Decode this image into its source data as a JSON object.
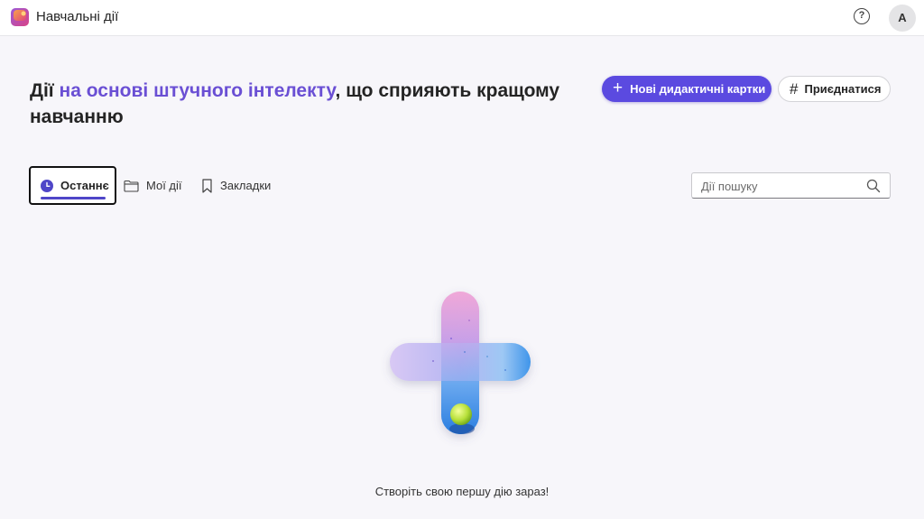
{
  "app": {
    "title": "Навчальні дії",
    "logo_icon": "learning-activities-logo-icon",
    "help_icon": "help-icon",
    "help_glyph": "?",
    "avatar_initial": "A"
  },
  "hero": {
    "title_part1": "Дії ",
    "title_highlight": "на основі штучного інтелекту",
    "title_part2": ", що сприяють кращому навчанню",
    "accent_color": "#6a4fd4"
  },
  "actions": {
    "new_flashcards_label": "Нові дидактичні картки",
    "new_icon": "plus-icon",
    "new_glyph": "+",
    "join_label": "Приєднатися",
    "join_icon": "hash-icon",
    "join_glyph": "#",
    "primary_color": "#5b4ae0"
  },
  "tabs": [
    {
      "label": "Останнє",
      "icon": "clock-icon",
      "selected": true
    },
    {
      "label": "Мої дії",
      "icon": "folder-icon",
      "selected": false
    },
    {
      "label": "Закладки",
      "icon": "bookmark-icon",
      "selected": false
    }
  ],
  "search": {
    "placeholder": "Дії пошуку",
    "value": "",
    "icon": "search-icon"
  },
  "empty_state": {
    "illustration": "plus-illustration",
    "message": "Створіть свою першу дію зараз!"
  }
}
